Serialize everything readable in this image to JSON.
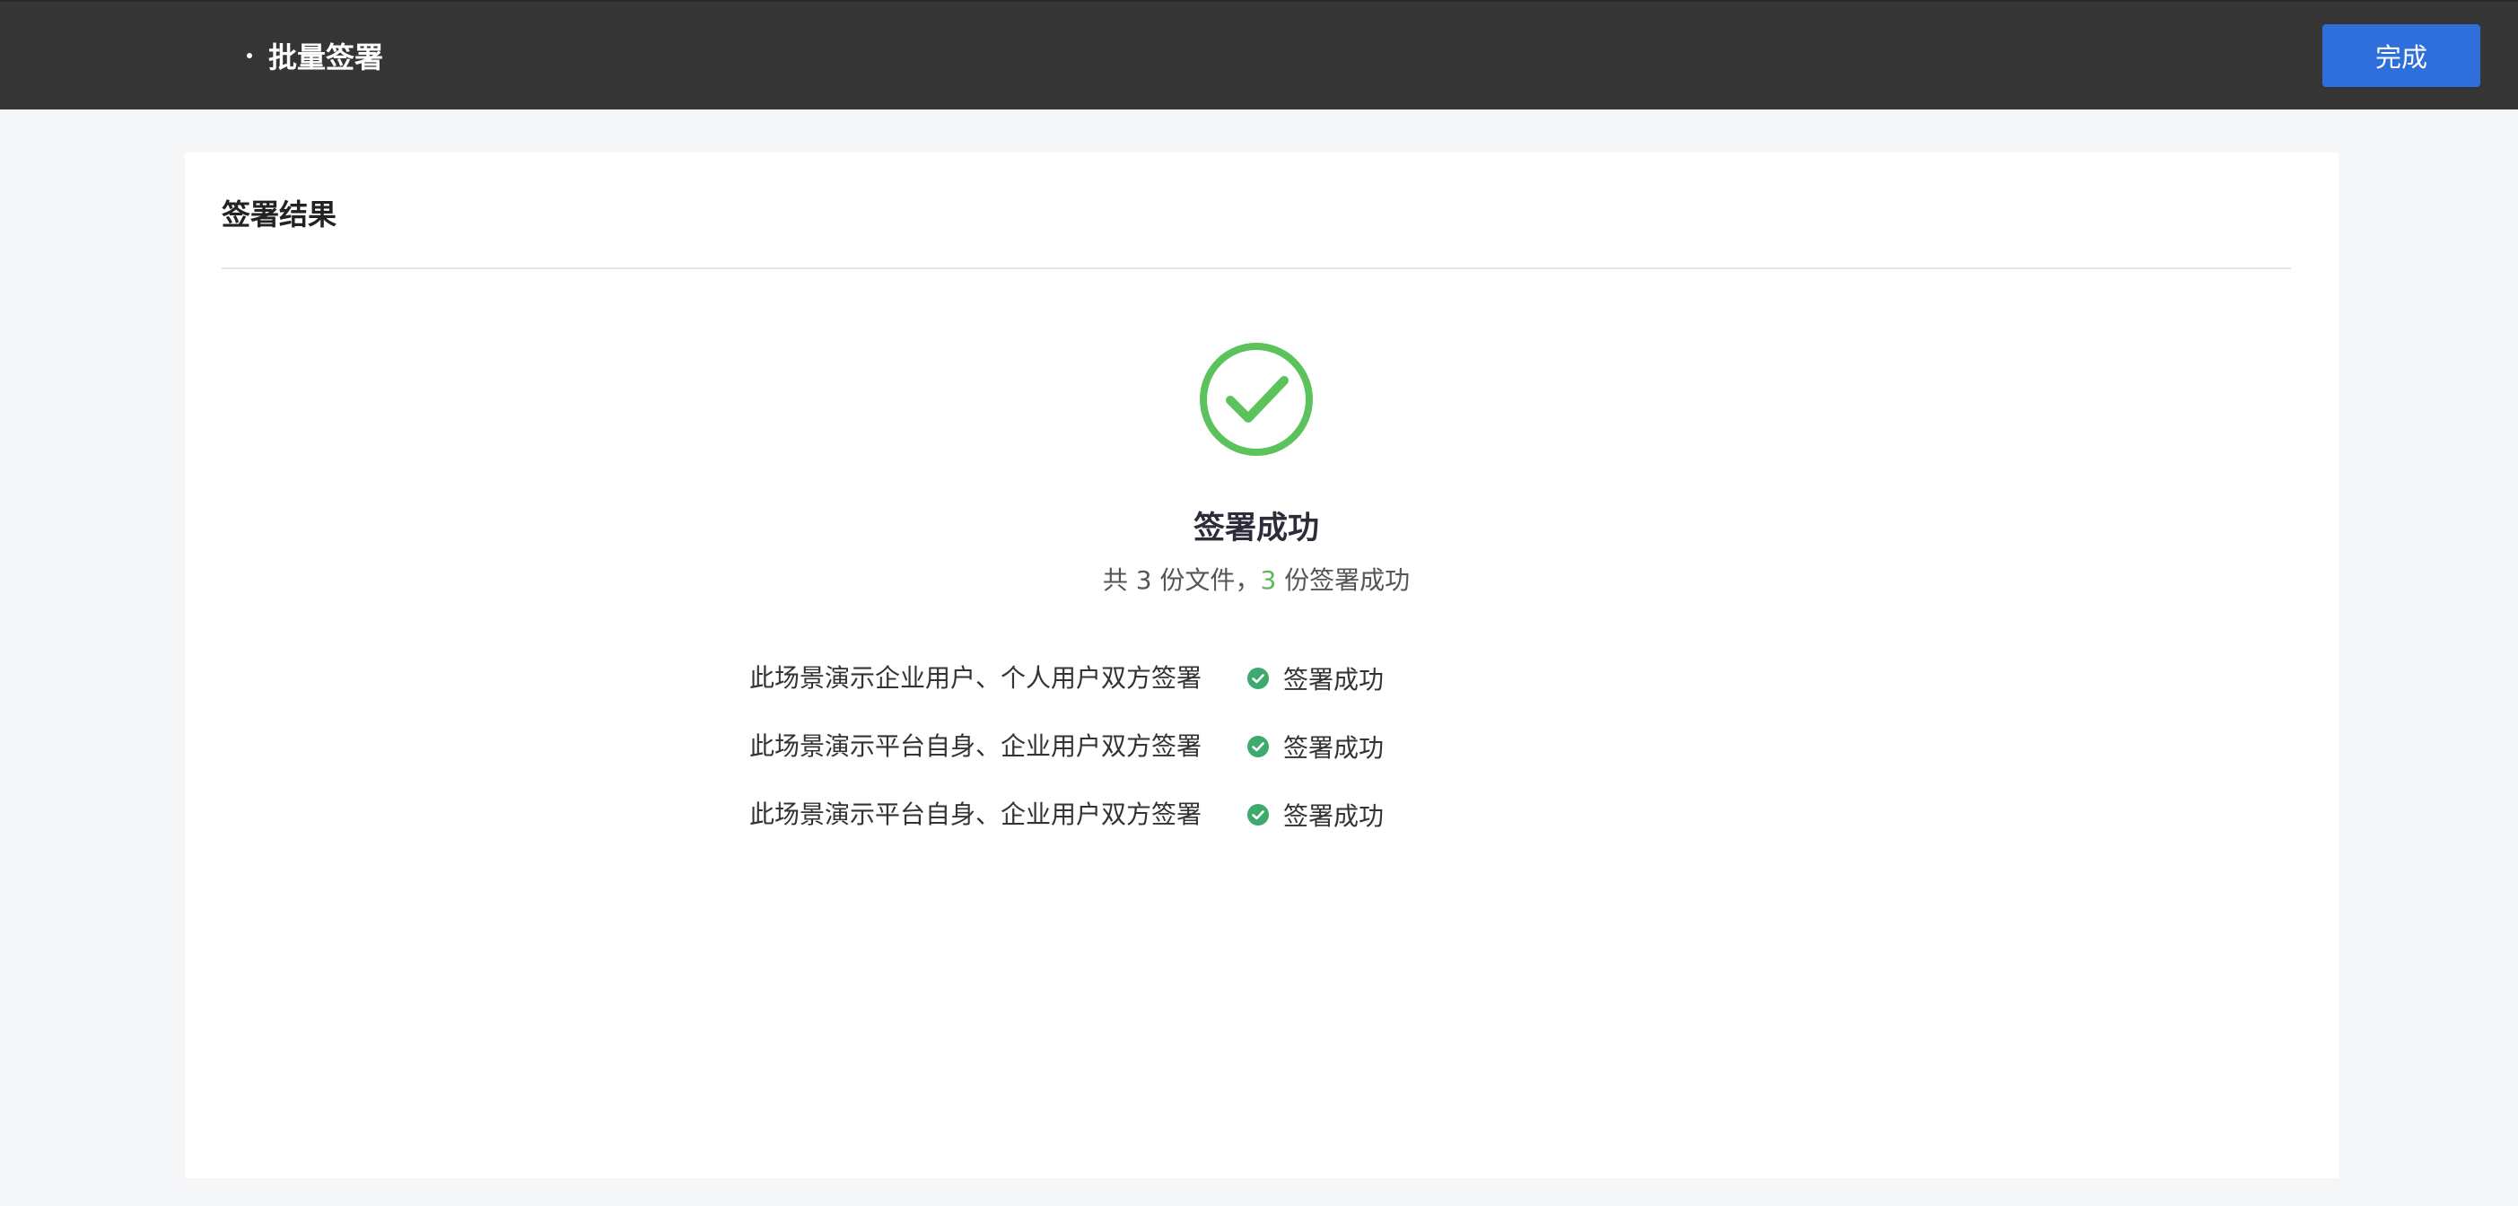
{
  "header": {
    "title": "批量签署",
    "done_label": "完成"
  },
  "card": {
    "title": "签署结果"
  },
  "result": {
    "title": "签署成功",
    "summary_prefix": "共 3 份文件，",
    "success_count": "3",
    "summary_suffix": " 份签署成功",
    "success_color": "#5cb85c"
  },
  "files": [
    {
      "name": "此场景演示企业用户、个人用户双方签署",
      "status": "签署成功",
      "status_icon": "check-circle-icon"
    },
    {
      "name": "此场景演示平台自身、企业用户双方签署",
      "status": "签署成功",
      "status_icon": "check-circle-icon"
    },
    {
      "name": "此场景演示平台自身、企业用户双方签署",
      "status": "签署成功",
      "status_icon": "check-circle-icon"
    }
  ],
  "colors": {
    "topbar": "#353535",
    "primary": "#2f6fdb",
    "success": "#5cb85c",
    "status_icon": "#3daa6e"
  }
}
